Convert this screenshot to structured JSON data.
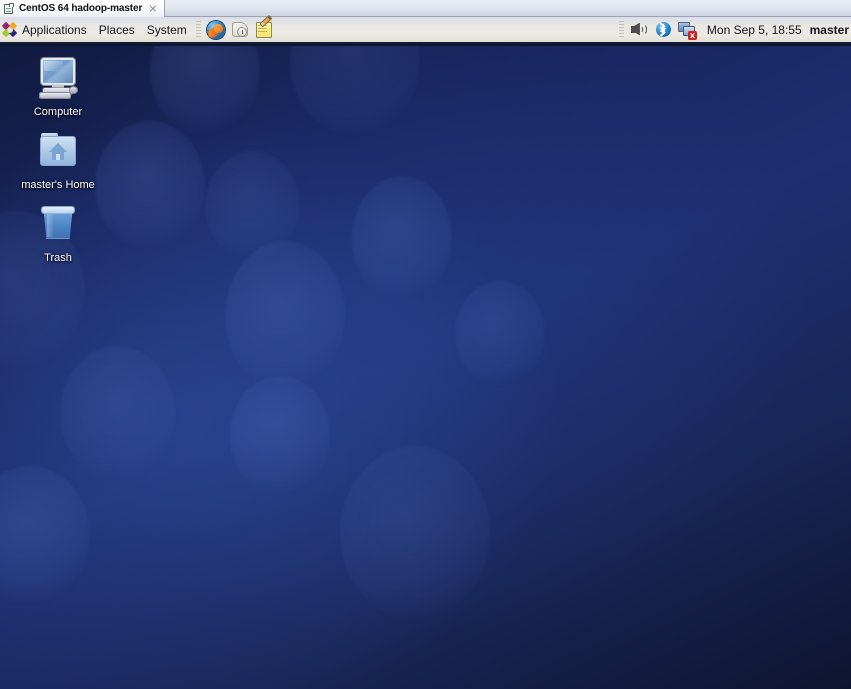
{
  "window": {
    "tab_title": "CentOS 64 hadoop-master",
    "tab_close_label": "×",
    "tab_icon": "virtual-machine-icon"
  },
  "panel": {
    "menus": [
      {
        "label": "Applications",
        "icon": "centos-logo-icon"
      },
      {
        "label": "Places",
        "icon": ""
      },
      {
        "label": "System",
        "icon": ""
      }
    ],
    "launchers": [
      {
        "name": "firefox-launcher",
        "icon": "firefox-icon",
        "label": "Firefox Web Browser"
      },
      {
        "name": "evolution-launcher",
        "icon": "evolution-mail-icon",
        "label": "Evolution Mail"
      },
      {
        "name": "text-editor-launcher",
        "icon": "text-editor-icon",
        "label": "Text Editor"
      }
    ],
    "tray": [
      {
        "name": "volume-tray-icon",
        "icon": "speaker-icon"
      },
      {
        "name": "bluetooth-tray-icon",
        "icon": "bluetooth-icon"
      },
      {
        "name": "network-tray-icon",
        "icon": "network-monitors-icon",
        "badge": "x",
        "badge_color": "#cf2222"
      }
    ],
    "clock": "Mon Sep  5, 18:55",
    "user": "master"
  },
  "desktop": {
    "icons": [
      {
        "name": "computer-desktop-icon",
        "label": "Computer",
        "icon": "computer-icon"
      },
      {
        "name": "home-desktop-icon",
        "label": "master's Home",
        "icon": "home-folder-icon"
      },
      {
        "name": "trash-desktop-icon",
        "label": "Trash",
        "icon": "trash-icon"
      }
    ]
  },
  "theme": {
    "panel_top": "#d9dde9",
    "panel_bottom": "#e2ded7",
    "panel_border": "#141c34",
    "wallpaper_dark": "#0e152f",
    "wallpaper_mid": "#1d2f70",
    "icon_label_color": "#ffffff",
    "accent_red": "#cf2222"
  }
}
